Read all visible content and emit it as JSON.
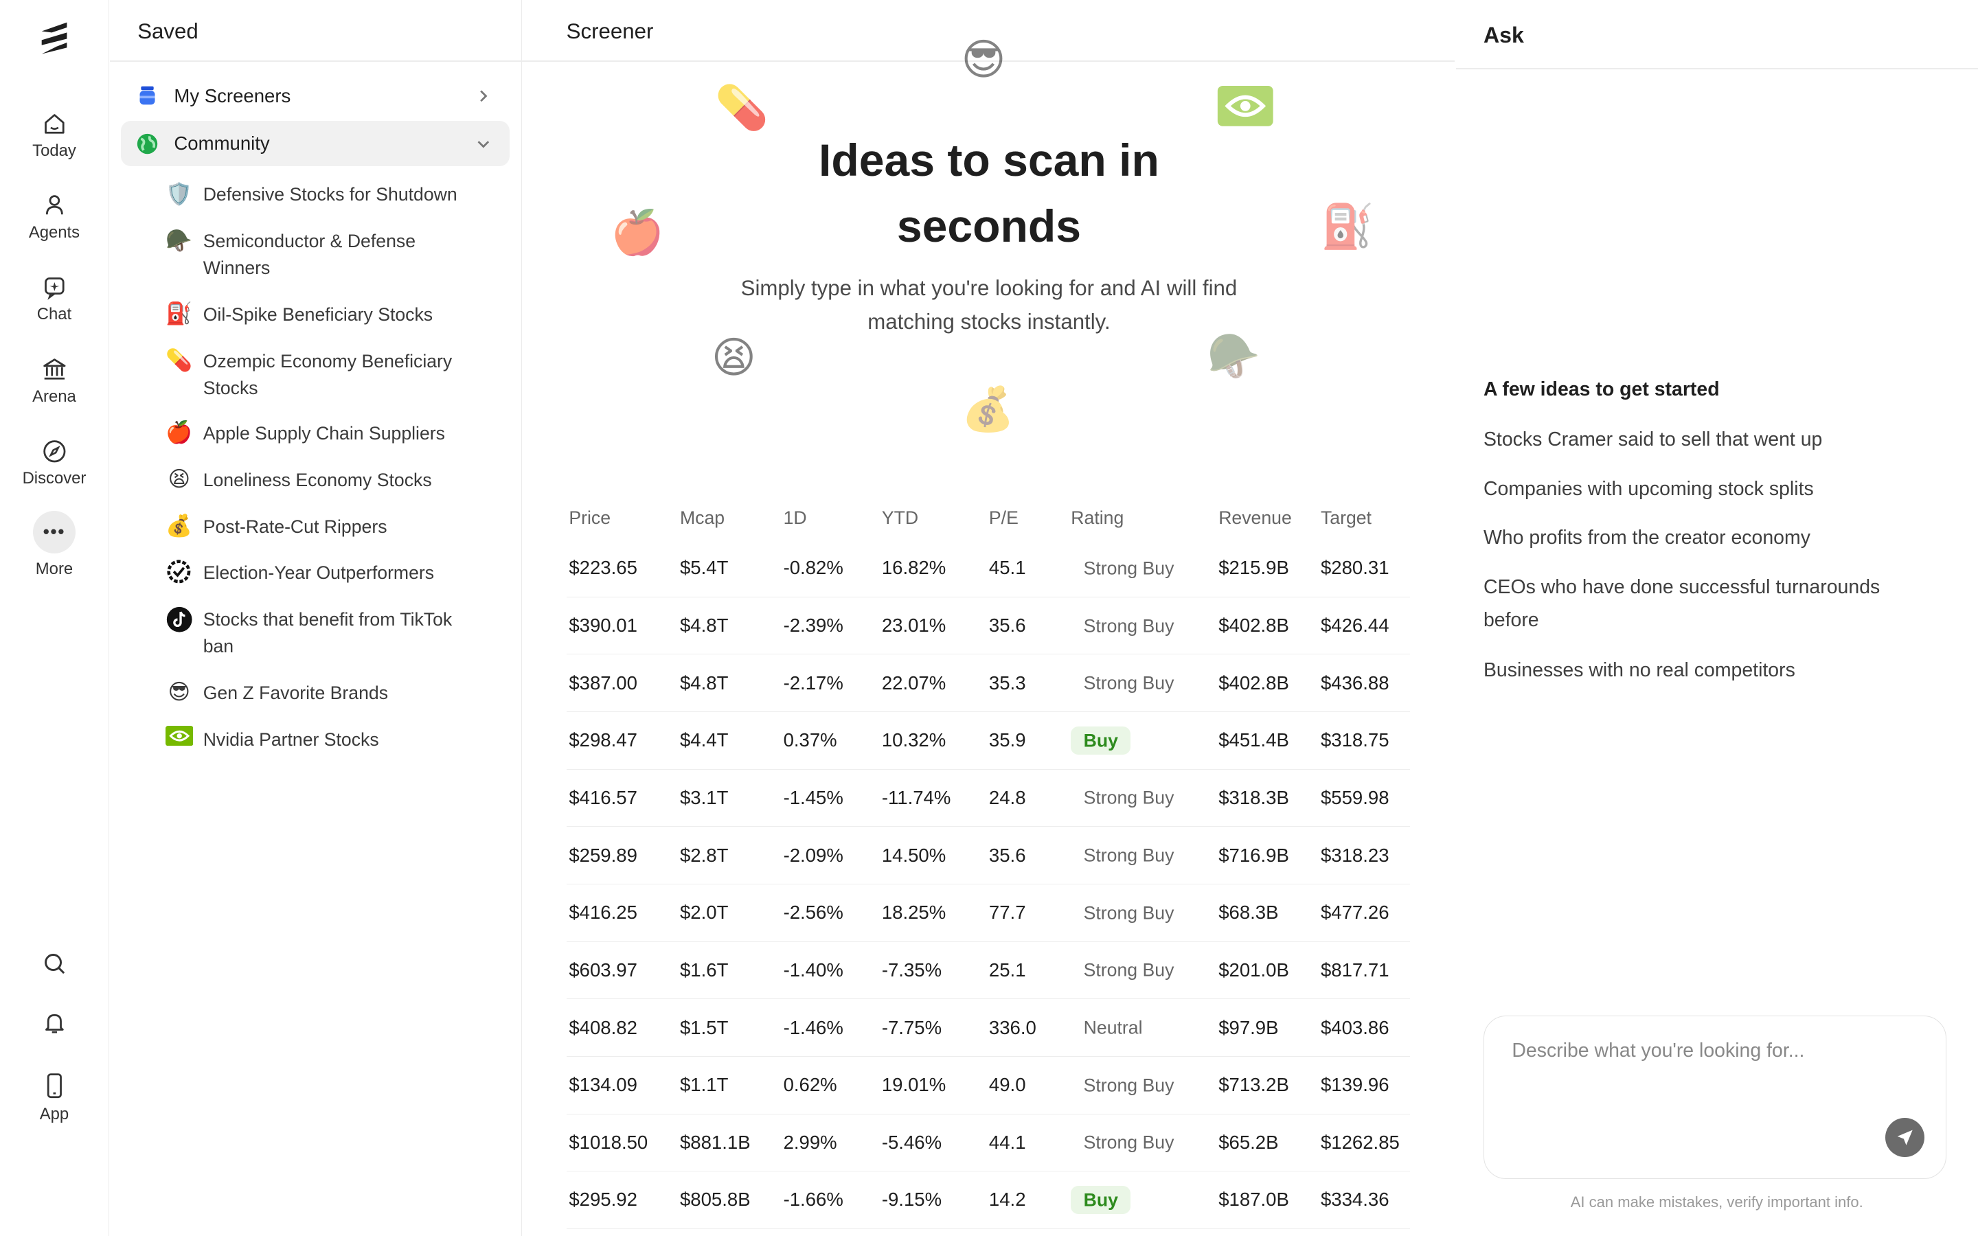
{
  "rail": {
    "nav": [
      {
        "label": "Today",
        "icon": "home-icon"
      },
      {
        "label": "Agents",
        "icon": "agent-icon"
      },
      {
        "label": "Chat",
        "icon": "chat-icon"
      },
      {
        "label": "Arena",
        "icon": "bank-icon"
      },
      {
        "label": "Discover",
        "icon": "compass-icon"
      },
      {
        "label": "More",
        "icon": "more-icon"
      }
    ],
    "bottom": {
      "app_label": "App"
    }
  },
  "saved": {
    "title": "Saved",
    "groups": [
      {
        "label": "My Screeners",
        "icon": "screener-jar-icon"
      },
      {
        "label": "Community",
        "icon": "globe-icon"
      }
    ],
    "community_items": [
      {
        "label": "Defensive Stocks for Shutdown",
        "icon": "shield-emoji"
      },
      {
        "label": "Semiconductor & Defense Winners",
        "icon": "tank-emoji"
      },
      {
        "label": "Oil-Spike Beneficiary Stocks",
        "icon": "fuel-can-emoji"
      },
      {
        "label": "Ozempic Economy Beneficiary Stocks",
        "icon": "pill-emoji"
      },
      {
        "label": "Apple Supply Chain Suppliers",
        "icon": "apple-emoji"
      },
      {
        "label": "Loneliness Economy Stocks",
        "icon": "tired-face-emoji"
      },
      {
        "label": "Post-Rate-Cut Rippers",
        "icon": "money-bag-emoji"
      },
      {
        "label": "Election-Year Outperformers",
        "icon": "ballot-emoji"
      },
      {
        "label": "Stocks that benefit from TikTok ban",
        "icon": "tiktok-logo"
      },
      {
        "label": "Gen Z Favorite Brands",
        "icon": "sunglasses-emoji"
      },
      {
        "label": "Nvidia Partner Stocks",
        "icon": "nvidia-logo"
      }
    ]
  },
  "screener": {
    "title": "Screener",
    "hero_title": "Ideas to scan in seconds",
    "hero_subtitle": "Simply type in what you're looking for and AI will find matching stocks instantly.",
    "columns": [
      "Price",
      "Mcap",
      "1D",
      "YTD",
      "P/E",
      "Rating",
      "Revenue",
      "Target"
    ],
    "rows": [
      {
        "price": "$223.65",
        "mcap": "$5.4T",
        "d1": "-0.82%",
        "d1_dir": "neg",
        "ytd": "16.82%",
        "ytd_dir": "pos",
        "pe": "45.1",
        "rating": "Strong Buy",
        "revenue": "$215.9B",
        "target": "$280.31"
      },
      {
        "price": "$390.01",
        "mcap": "$4.8T",
        "d1": "-2.39%",
        "d1_dir": "neg",
        "ytd": "23.01%",
        "ytd_dir": "pos",
        "pe": "35.6",
        "rating": "Strong Buy",
        "revenue": "$402.8B",
        "target": "$426.44"
      },
      {
        "price": "$387.00",
        "mcap": "$4.8T",
        "d1": "-2.17%",
        "d1_dir": "neg",
        "ytd": "22.07%",
        "ytd_dir": "pos",
        "pe": "35.3",
        "rating": "Strong Buy",
        "revenue": "$402.8B",
        "target": "$436.88"
      },
      {
        "price": "$298.47",
        "mcap": "$4.4T",
        "d1": "0.37%",
        "d1_dir": "pos",
        "ytd": "10.32%",
        "ytd_dir": "pos",
        "pe": "35.9",
        "rating": "Buy",
        "revenue": "$451.4B",
        "target": "$318.75"
      },
      {
        "price": "$416.57",
        "mcap": "$3.1T",
        "d1": "-1.45%",
        "d1_dir": "neg",
        "ytd": "-11.74%",
        "ytd_dir": "neg",
        "pe": "24.8",
        "rating": "Strong Buy",
        "revenue": "$318.3B",
        "target": "$559.98"
      },
      {
        "price": "$259.89",
        "mcap": "$2.8T",
        "d1": "-2.09%",
        "d1_dir": "neg",
        "ytd": "14.50%",
        "ytd_dir": "pos",
        "pe": "35.6",
        "rating": "Strong Buy",
        "revenue": "$716.9B",
        "target": "$318.23"
      },
      {
        "price": "$416.25",
        "mcap": "$2.0T",
        "d1": "-2.56%",
        "d1_dir": "neg",
        "ytd": "18.25%",
        "ytd_dir": "pos",
        "pe": "77.7",
        "rating": "Strong Buy",
        "revenue": "$68.3B",
        "target": "$477.26"
      },
      {
        "price": "$603.97",
        "mcap": "$1.6T",
        "d1": "-1.40%",
        "d1_dir": "neg",
        "ytd": "-7.35%",
        "ytd_dir": "neg",
        "pe": "25.1",
        "rating": "Strong Buy",
        "revenue": "$201.0B",
        "target": "$817.71"
      },
      {
        "price": "$408.82",
        "mcap": "$1.5T",
        "d1": "-1.46%",
        "d1_dir": "neg",
        "ytd": "-7.75%",
        "ytd_dir": "neg",
        "pe": "336.0",
        "rating": "Neutral",
        "revenue": "$97.9B",
        "target": "$403.86"
      },
      {
        "price": "$134.09",
        "mcap": "$1.1T",
        "d1": "0.62%",
        "d1_dir": "pos",
        "ytd": "19.01%",
        "ytd_dir": "pos",
        "pe": "49.0",
        "rating": "Strong Buy",
        "revenue": "$713.2B",
        "target": "$139.96"
      },
      {
        "price": "$1018.50",
        "mcap": "$881.1B",
        "d1": "2.99%",
        "d1_dir": "pos",
        "ytd": "-5.46%",
        "ytd_dir": "neg",
        "pe": "44.1",
        "rating": "Strong Buy",
        "revenue": "$65.2B",
        "target": "$1262.85"
      },
      {
        "price": "$295.92",
        "mcap": "$805.8B",
        "d1": "-1.66%",
        "d1_dir": "neg",
        "ytd": "-9.15%",
        "ytd_dir": "neg",
        "pe": "14.2",
        "rating": "Buy",
        "revenue": "$187.0B",
        "target": "$334.36"
      }
    ]
  },
  "ask": {
    "title": "Ask",
    "ideas_heading": "A few ideas to get started",
    "ideas": [
      "Stocks Cramer said to sell that went up",
      "Companies with upcoming stock splits",
      "Who profits from the creator economy",
      "CEOs who have done successful turnarounds before",
      "Businesses with no real competitors"
    ],
    "input_placeholder": "Describe what you're looking for...",
    "disclaimer": "AI can make mistakes, verify important info."
  },
  "colors": {
    "negative": "#c8102e",
    "positive": "#1a8c3e",
    "buy_badge_bg": "#eaf6e6"
  }
}
